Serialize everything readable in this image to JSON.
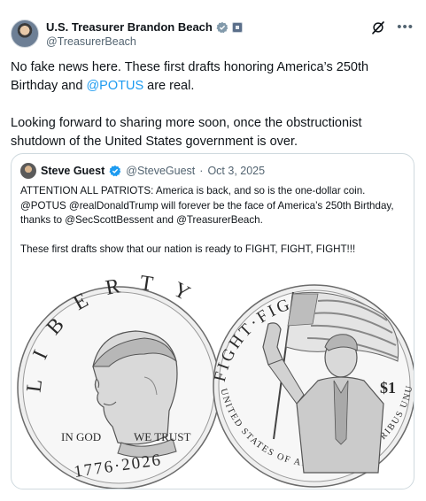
{
  "post": {
    "author": {
      "display_name": "U.S. Treasurer Brandon Beach",
      "handle": "@TreasurerBeach",
      "verified_color": "#829aab"
    },
    "paragraph1_pre": "No fake news here. These first drafts honoring America’s 250th Birthday and ",
    "paragraph1_mention": "@POTUS",
    "paragraph1_post": " are real.",
    "paragraph2": "Looking forward to sharing more soon, once the obstructionist shutdown of the United States government is over.",
    "icons": [
      "grok-icon",
      "more-icon"
    ]
  },
  "quote": {
    "author": {
      "display_name": "Steve Guest",
      "handle": "@SteveGuest",
      "separator": "·",
      "date": "Oct 3, 2025",
      "verified_color": "#1d9bf0"
    },
    "paragraph1": "ATTENTION ALL PATRIOTS: America is back, and so is the one-dollar coin. @POTUS @realDonaldTrump will forever be the face of America’s 250th Birthday, thanks to @SecScottBessent and @TreasurerBeach.",
    "paragraph2": "These first drafts show that our nation is ready to FIGHT, FIGHT, FIGHT!!!"
  },
  "coins": {
    "obverse": {
      "rim_text": "LIBERTY",
      "motto_left": "IN GOD",
      "motto_right": "WE TRUST",
      "dates": "1776·2026"
    },
    "reverse": {
      "rim_top": "FIGHT·FIGHT·FIGHT",
      "rim_bottom": "UNITED STATES OF AMERICA · E PLURIBUS UNUM",
      "denomination": "$1"
    }
  },
  "colors": {
    "link": "#1d9bf0",
    "secondary_text": "#536471",
    "border": "#cfd9de"
  }
}
